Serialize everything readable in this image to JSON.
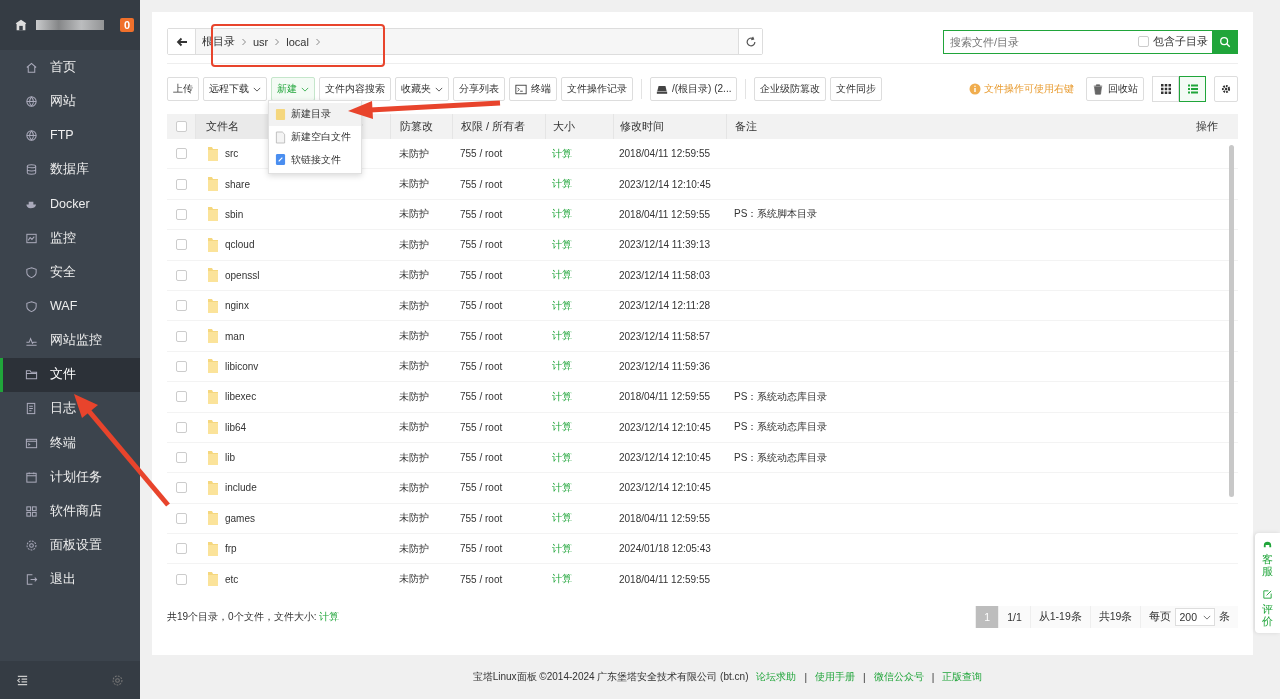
{
  "sidebar": {
    "badge": "0",
    "items": [
      {
        "label": "首页",
        "selected": false
      },
      {
        "label": "网站",
        "selected": false
      },
      {
        "label": "FTP",
        "selected": false
      },
      {
        "label": "数据库",
        "selected": false
      },
      {
        "label": "Docker",
        "selected": false
      },
      {
        "label": "监控",
        "selected": false
      },
      {
        "label": "安全",
        "selected": false
      },
      {
        "label": "WAF",
        "selected": false
      },
      {
        "label": "网站监控",
        "selected": false
      },
      {
        "label": "文件",
        "selected": true
      },
      {
        "label": "日志",
        "selected": false
      },
      {
        "label": "终端",
        "selected": false
      },
      {
        "label": "计划任务",
        "selected": false
      },
      {
        "label": "软件商店",
        "selected": false
      },
      {
        "label": "面板设置",
        "selected": false
      },
      {
        "label": "退出",
        "selected": false
      }
    ]
  },
  "path": [
    "根目录",
    "usr",
    "local"
  ],
  "search": {
    "placeholder": "搜索文件/目录",
    "include_sub_label": "包含子目录",
    "include_sub": false
  },
  "toolbar": [
    {
      "label": "上传",
      "kind": "plain",
      "active": false
    },
    {
      "label": "远程下载",
      "kind": "dropdown",
      "active": false
    },
    {
      "label": "新建",
      "kind": "dropdown",
      "active": true
    },
    {
      "label": "文件内容搜索",
      "kind": "plain",
      "active": false
    },
    {
      "label": "收藏夹",
      "kind": "dropdown",
      "active": false
    },
    {
      "label": "分享列表",
      "kind": "plain",
      "active": false
    },
    {
      "label": "终端",
      "kind": "terminal",
      "active": false
    },
    {
      "label": "文件操作记录",
      "kind": "plain",
      "active": false
    },
    {
      "label": "/(根目录) (2...",
      "kind": "disk",
      "active": false
    },
    {
      "label": "企业级防篡改",
      "kind": "plain",
      "active": false
    },
    {
      "label": "文件同步",
      "kind": "plain",
      "active": false
    }
  ],
  "hint": "文件操作可使用右键",
  "recycle": "回收站",
  "view": {
    "grid": false,
    "list": true
  },
  "menu": [
    {
      "label": "新建目录",
      "kind": "folder",
      "selected": true
    },
    {
      "label": "新建空白文件",
      "kind": "file",
      "selected": false
    },
    {
      "label": "软链接文件",
      "kind": "link",
      "selected": false
    }
  ],
  "select_all_checked": false,
  "columns": [
    "文件名",
    "防篡改",
    "权限 / 所有者",
    "大小",
    "修改时间",
    "备注",
    "操作"
  ],
  "rows": [
    {
      "name": "src",
      "checked": false,
      "protect": "未防护",
      "perm": "755 / root",
      "size": "计算",
      "time": "2018/04/11 12:59:55"
    },
    {
      "name": "share",
      "checked": false,
      "protect": "未防护",
      "perm": "755 / root",
      "size": "计算",
      "time": "2023/12/14 12:10:45"
    },
    {
      "name": "sbin",
      "checked": false,
      "protect": "未防护",
      "perm": "755 / root",
      "size": "计算",
      "time": "2018/04/11 12:59:55",
      "note": "PS：系统脚本目录"
    },
    {
      "name": "qcloud",
      "checked": false,
      "protect": "未防护",
      "perm": "755 / root",
      "size": "计算",
      "time": "2023/12/14 11:39:13"
    },
    {
      "name": "openssl",
      "checked": false,
      "protect": "未防护",
      "perm": "755 / root",
      "size": "计算",
      "time": "2023/12/14 11:58:03"
    },
    {
      "name": "nginx",
      "checked": false,
      "protect": "未防护",
      "perm": "755 / root",
      "size": "计算",
      "time": "2023/12/14 12:11:28"
    },
    {
      "name": "man",
      "checked": false,
      "protect": "未防护",
      "perm": "755 / root",
      "size": "计算",
      "time": "2023/12/14 11:58:57"
    },
    {
      "name": "libiconv",
      "checked": false,
      "protect": "未防护",
      "perm": "755 / root",
      "size": "计算",
      "time": "2023/12/14 11:59:36"
    },
    {
      "name": "libexec",
      "checked": false,
      "protect": "未防护",
      "perm": "755 / root",
      "size": "计算",
      "time": "2018/04/11 12:59:55",
      "note": "PS：系统动态库目录"
    },
    {
      "name": "lib64",
      "checked": false,
      "protect": "未防护",
      "perm": "755 / root",
      "size": "计算",
      "time": "2023/12/14 12:10:45",
      "note": "PS：系统动态库目录"
    },
    {
      "name": "lib",
      "checked": false,
      "protect": "未防护",
      "perm": "755 / root",
      "size": "计算",
      "time": "2023/12/14 12:10:45",
      "note": "PS：系统动态库目录"
    },
    {
      "name": "include",
      "checked": false,
      "protect": "未防护",
      "perm": "755 / root",
      "size": "计算",
      "time": "2023/12/14 12:10:45"
    },
    {
      "name": "games",
      "checked": false,
      "protect": "未防护",
      "perm": "755 / root",
      "size": "计算",
      "time": "2018/04/11 12:59:55"
    },
    {
      "name": "frp",
      "checked": false,
      "protect": "未防护",
      "perm": "755 / root",
      "size": "计算",
      "time": "2024/01/18 12:05:43"
    },
    {
      "name": "etc",
      "checked": false,
      "protect": "未防护",
      "perm": "755 / root",
      "size": "计算",
      "time": "2018/04/11 12:59:55"
    }
  ],
  "summary": {
    "text": "共19个目录，0个文件，文件大小:",
    "link": "计算"
  },
  "pager": {
    "page": "1",
    "pages": "1/1",
    "range": "从1-19条",
    "total": "共19条",
    "per_label": "每页",
    "per": "200",
    "unit": "条"
  },
  "float": [
    {
      "label": "客服",
      "kind": "service"
    },
    {
      "label": "评价",
      "kind": "edit"
    }
  ],
  "footer": {
    "copyright": "宝塔Linux面板 ©2014-2024 广东堡塔安全技术有限公司 (bt.cn)",
    "links": [
      {
        "label": "论坛求助"
      },
      {
        "separator": "|",
        "label": "使用手册"
      },
      {
        "separator": "|",
        "label": "微信公众号"
      },
      {
        "separator": "|",
        "label": "正版查询"
      }
    ]
  }
}
